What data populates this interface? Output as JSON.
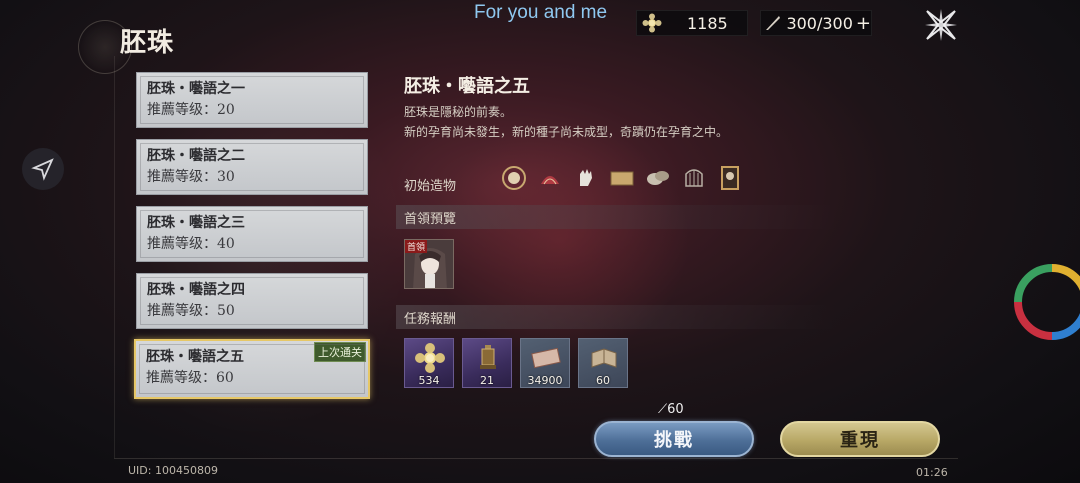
{
  "overlay": {
    "title": "For you and me"
  },
  "header": {
    "title": "胚珠"
  },
  "currency": {
    "gold": "1185",
    "energy": "300/300",
    "energy_plus": "+"
  },
  "levels": [
    {
      "name": "胚珠・囈語之一",
      "req": "推薦等级：20"
    },
    {
      "name": "胚珠・囈語之二",
      "req": "推薦等级：30"
    },
    {
      "name": "胚珠・囈語之三",
      "req": "推薦等级：40"
    },
    {
      "name": "胚珠・囈語之四",
      "req": "推薦等级：50"
    },
    {
      "name": "胚珠・囈語之五",
      "req": "推薦等级：60",
      "badge": "上次通关"
    }
  ],
  "detail": {
    "title": "胚珠・囈語之五",
    "desc1": "胚珠是隱秘的前奏。",
    "desc2": "新的孕育尚未發生，新的種子尚未成型，奇蹟仍在孕育之中。",
    "relics_label": "初始造物",
    "boss_label": "首領預覽",
    "boss_tag": "首領",
    "rewards_label": "任務報酬",
    "rewards": [
      "534",
      "21",
      "34900",
      "60"
    ]
  },
  "actions": {
    "cost": "60",
    "challenge": "挑戰",
    "replay": "重現"
  },
  "footer": {
    "uid": "UID: 100450809",
    "time": "01:26"
  },
  "colors": {
    "selected_border": "#e6c766",
    "challenge": "#4e6f98",
    "replay": "#b8a866",
    "badge": "#3f5b2c"
  }
}
